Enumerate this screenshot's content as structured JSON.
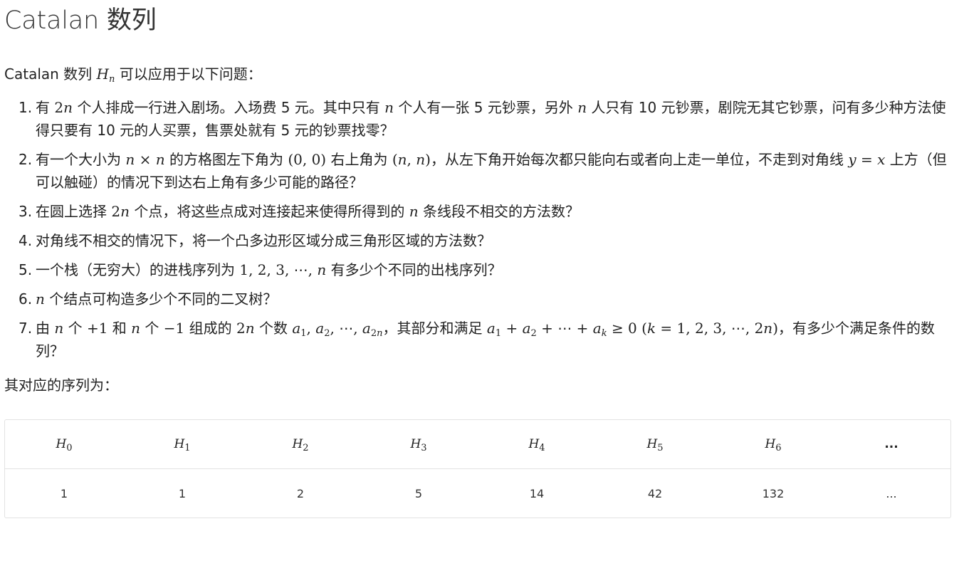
{
  "title": "Catalan 数列",
  "intro": {
    "pre": "Catalan 数列 ",
    "symbol": "H",
    "sub": "n",
    "post": " 可以应用于以下问题："
  },
  "problems": [
    "有 2n 个人排成一行进入剧场。入场费 5 元。其中只有 n 个人有一张 5 元钞票，另外 n 人只有 10 元钞票，剧院无其它钞票，问有多少种方法使得只要有 10 元的人买票，售票处就有 5 元的钞票找零？",
    "有一个大小为 n × n 的方格图左下角为 (0, 0) 右上角为 (n, n)，从左下角开始每次都只能向右或者向上走一单位，不走到对角线 y = x 上方（但可以触碰）的情况下到达右上角有多少可能的路径？",
    "在圆上选择 2n 个点，将这些点成对连接起来使得所得到的 n 条线段不相交的方法数？",
    "对角线不相交的情况下，将一个凸多边形区域分成三角形区域的方法数？",
    "一个栈（无穷大）的进栈序列为 1, 2, 3, ⋯, n 有多少个不同的出栈序列？",
    "n 个结点可构造多少个不同的二叉树？",
    "由 n 个 +1 和 n 个 −1 组成的 2n 个数 a1, a2, ⋯, a2n，其部分和满足 a1 + a2 + ⋯ + ak ≥ 0 (k = 1, 2, 3, ⋯, 2n)，有多少个满足条件的数列？"
  ],
  "sequence_intro": "其对应的序列为：",
  "table": {
    "headers": [
      {
        "sym": "H",
        "sub": "0"
      },
      {
        "sym": "H",
        "sub": "1"
      },
      {
        "sym": "H",
        "sub": "2"
      },
      {
        "sym": "H",
        "sub": "3"
      },
      {
        "sym": "H",
        "sub": "4"
      },
      {
        "sym": "H",
        "sub": "5"
      },
      {
        "sym": "H",
        "sub": "6"
      },
      {
        "sym": "...",
        "sub": ""
      }
    ],
    "values": [
      "1",
      "1",
      "2",
      "5",
      "14",
      "42",
      "132",
      "..."
    ]
  }
}
